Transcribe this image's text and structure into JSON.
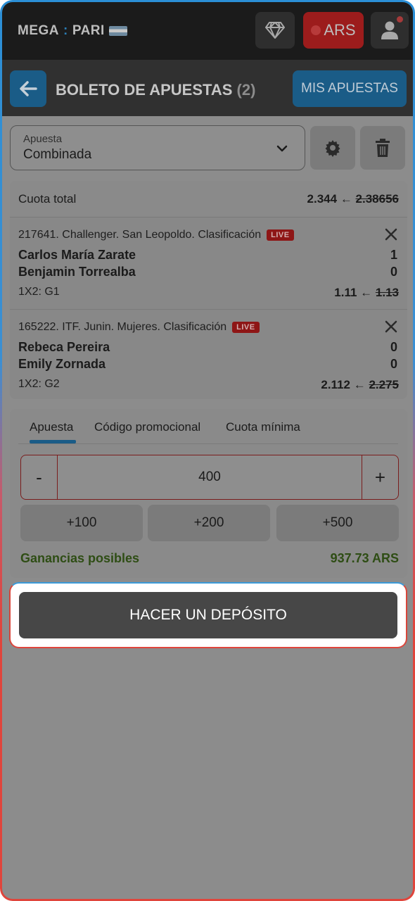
{
  "topbar": {
    "logo_left": "MEGA",
    "logo_right": "PARI",
    "currency": "ARS"
  },
  "header": {
    "title": "BOLETO DE APUESTAS",
    "count": "(2)",
    "my_bets": "MIS APUESTAS"
  },
  "bet_type": {
    "label": "Apuesta",
    "value": "Combinada"
  },
  "total": {
    "label": "Cuota total",
    "new_odds": "2.344",
    "old_odds": "2.38656"
  },
  "events": [
    {
      "league": "217641. Challenger. San Leopoldo. Clasificación",
      "live": "LIVE",
      "team1": "Carlos María Zarate",
      "score1": "1",
      "team2": "Benjamin Torrealba",
      "score2": "0",
      "market": "1X2: G1",
      "new_odds": "1.11",
      "old_odds": "1.13"
    },
    {
      "league": "165222. ITF. Junin. Mujeres. Clasificación",
      "live": "LIVE",
      "team1": "Rebeca Pereira",
      "score1": "0",
      "team2": "Emily Zornada",
      "score2": "0",
      "market": "1X2: G2",
      "new_odds": "2.112",
      "old_odds": "2.275"
    }
  ],
  "tabs": [
    "Apuesta",
    "Código promocional",
    "Cuota mínima"
  ],
  "stake": {
    "minus": "-",
    "value": "400",
    "plus": "+",
    "quick": [
      "+100",
      "+200",
      "+500"
    ]
  },
  "gains": {
    "label": "Ganancias posibles",
    "value": "937.73 ARS"
  },
  "deposit_label": "HACER UN DEPÓSITO",
  "arrow": "←"
}
